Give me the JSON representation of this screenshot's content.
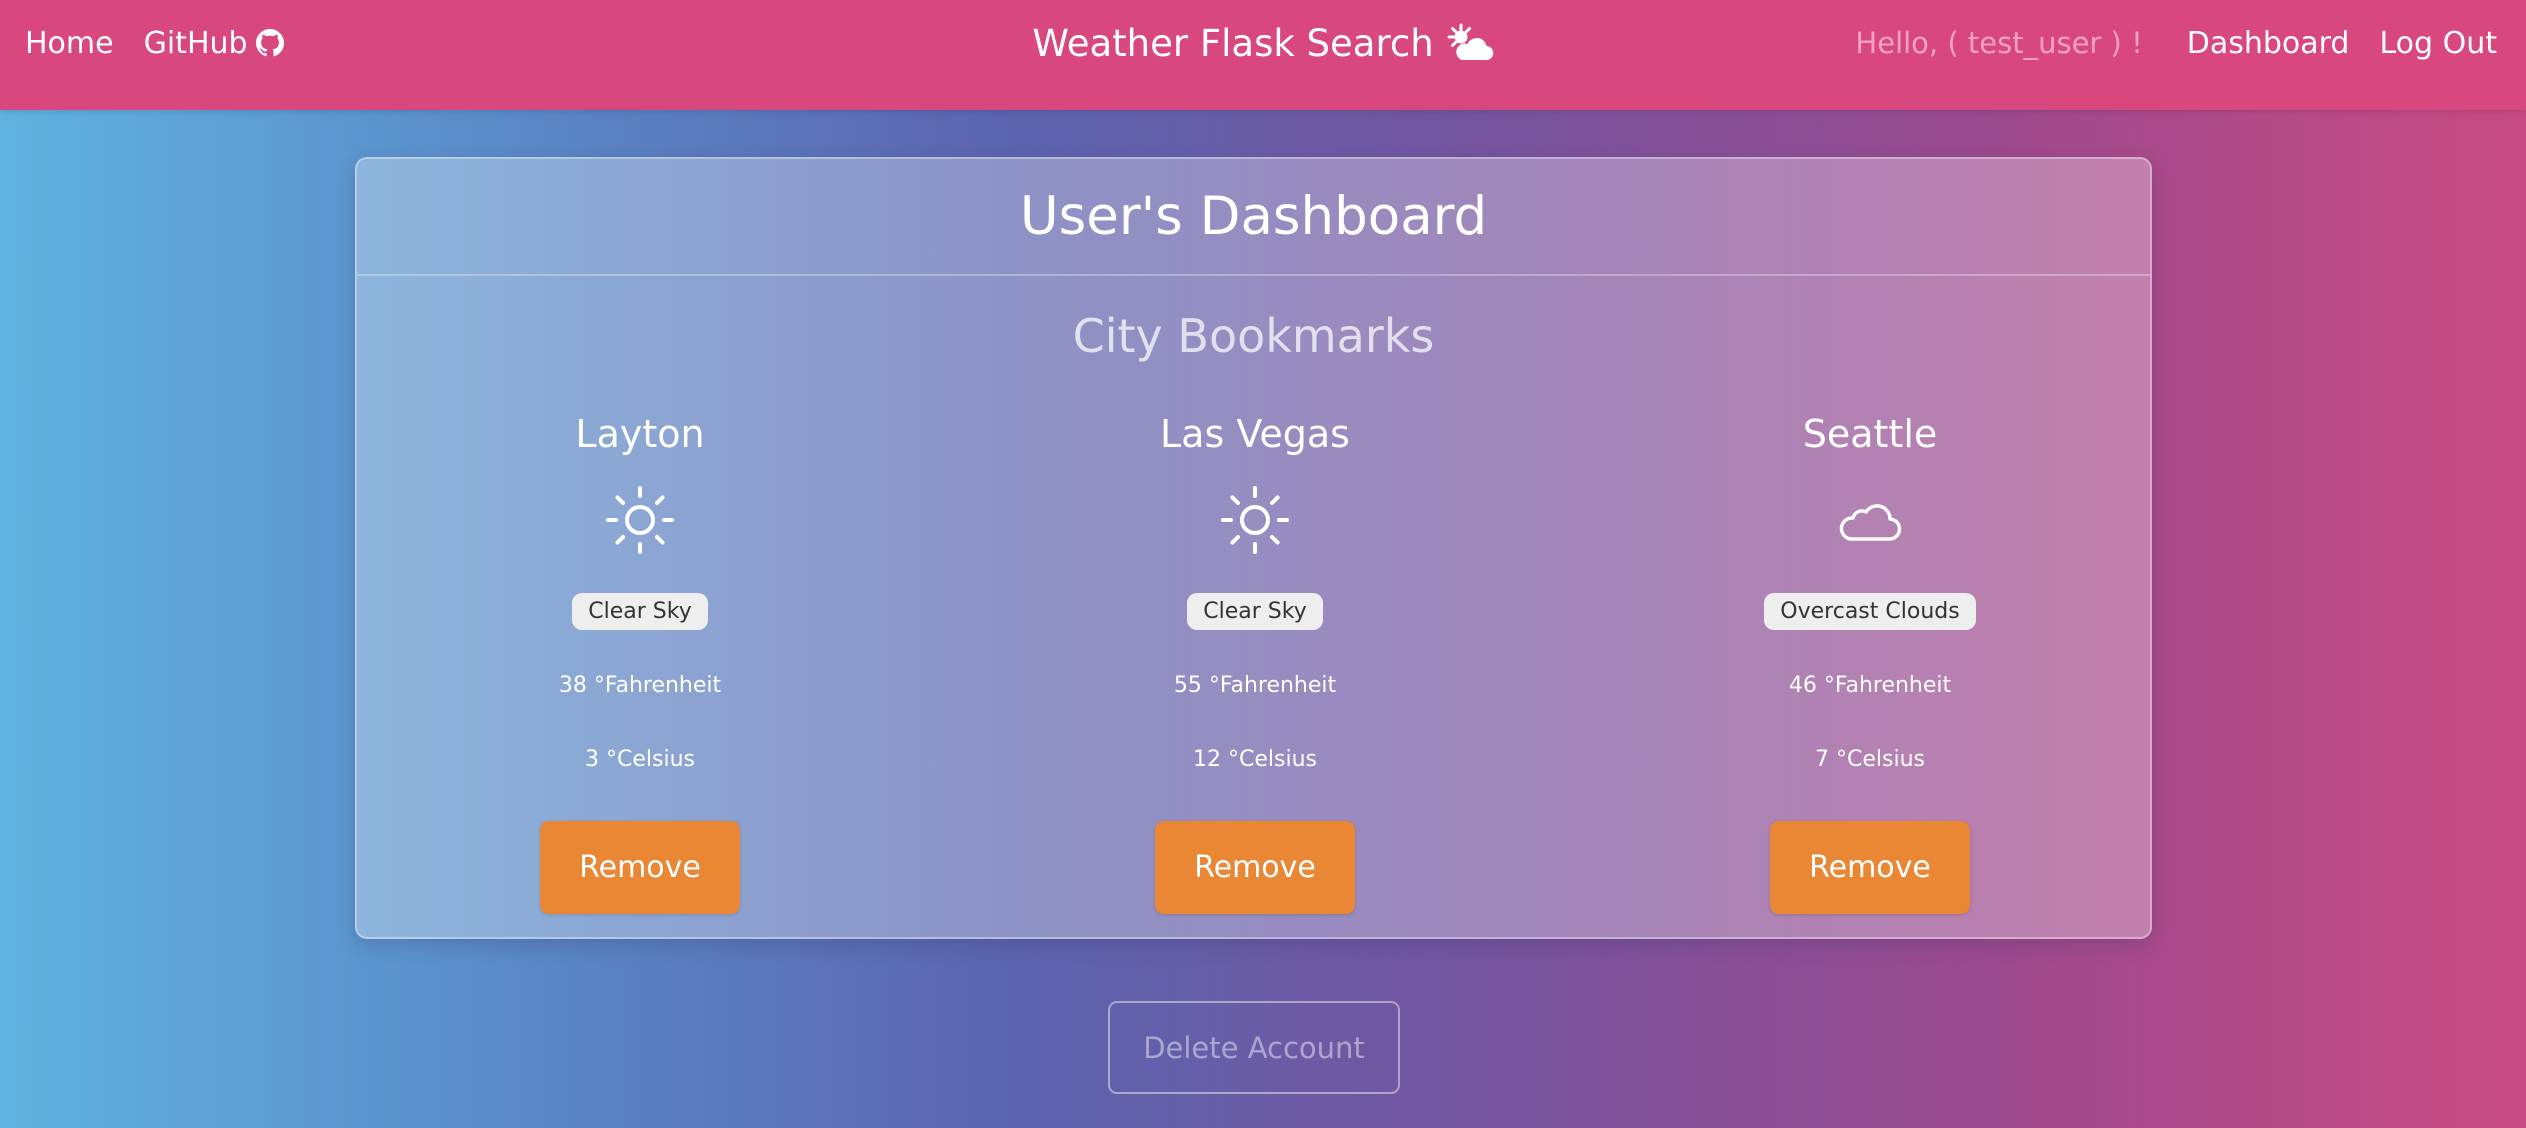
{
  "navbar": {
    "home_label": "Home",
    "github_label": "GitHub",
    "brand": "Weather Flask Search",
    "greeting": "Hello, ( test_user ) !",
    "dashboard_label": "Dashboard",
    "logout_label": "Log Out",
    "icons": [
      "github-icon",
      "sun-cloud-icon"
    ]
  },
  "dashboard": {
    "title": "User's Dashboard",
    "subtitle": "City Bookmarks",
    "cities": [
      {
        "name": "Layton",
        "icon": "sun-icon",
        "condition": "Clear Sky",
        "fahrenheit": "38 °Fahrenheit",
        "celsius": "3 °Celsius",
        "remove_label": "Remove"
      },
      {
        "name": "Las Vegas",
        "icon": "sun-icon",
        "condition": "Clear Sky",
        "fahrenheit": "55 °Fahrenheit",
        "celsius": "12 °Celsius",
        "remove_label": "Remove"
      },
      {
        "name": "Seattle",
        "icon": "cloud-icon",
        "condition": "Overcast Clouds",
        "fahrenheit": "46 °Fahrenheit",
        "celsius": "7 °Celsius",
        "remove_label": "Remove"
      }
    ],
    "delete_account_label": "Delete Account"
  },
  "colors": {
    "navbar": "#d9477f",
    "button_orange": "#e98735",
    "greeting": "#f4a2c0"
  }
}
